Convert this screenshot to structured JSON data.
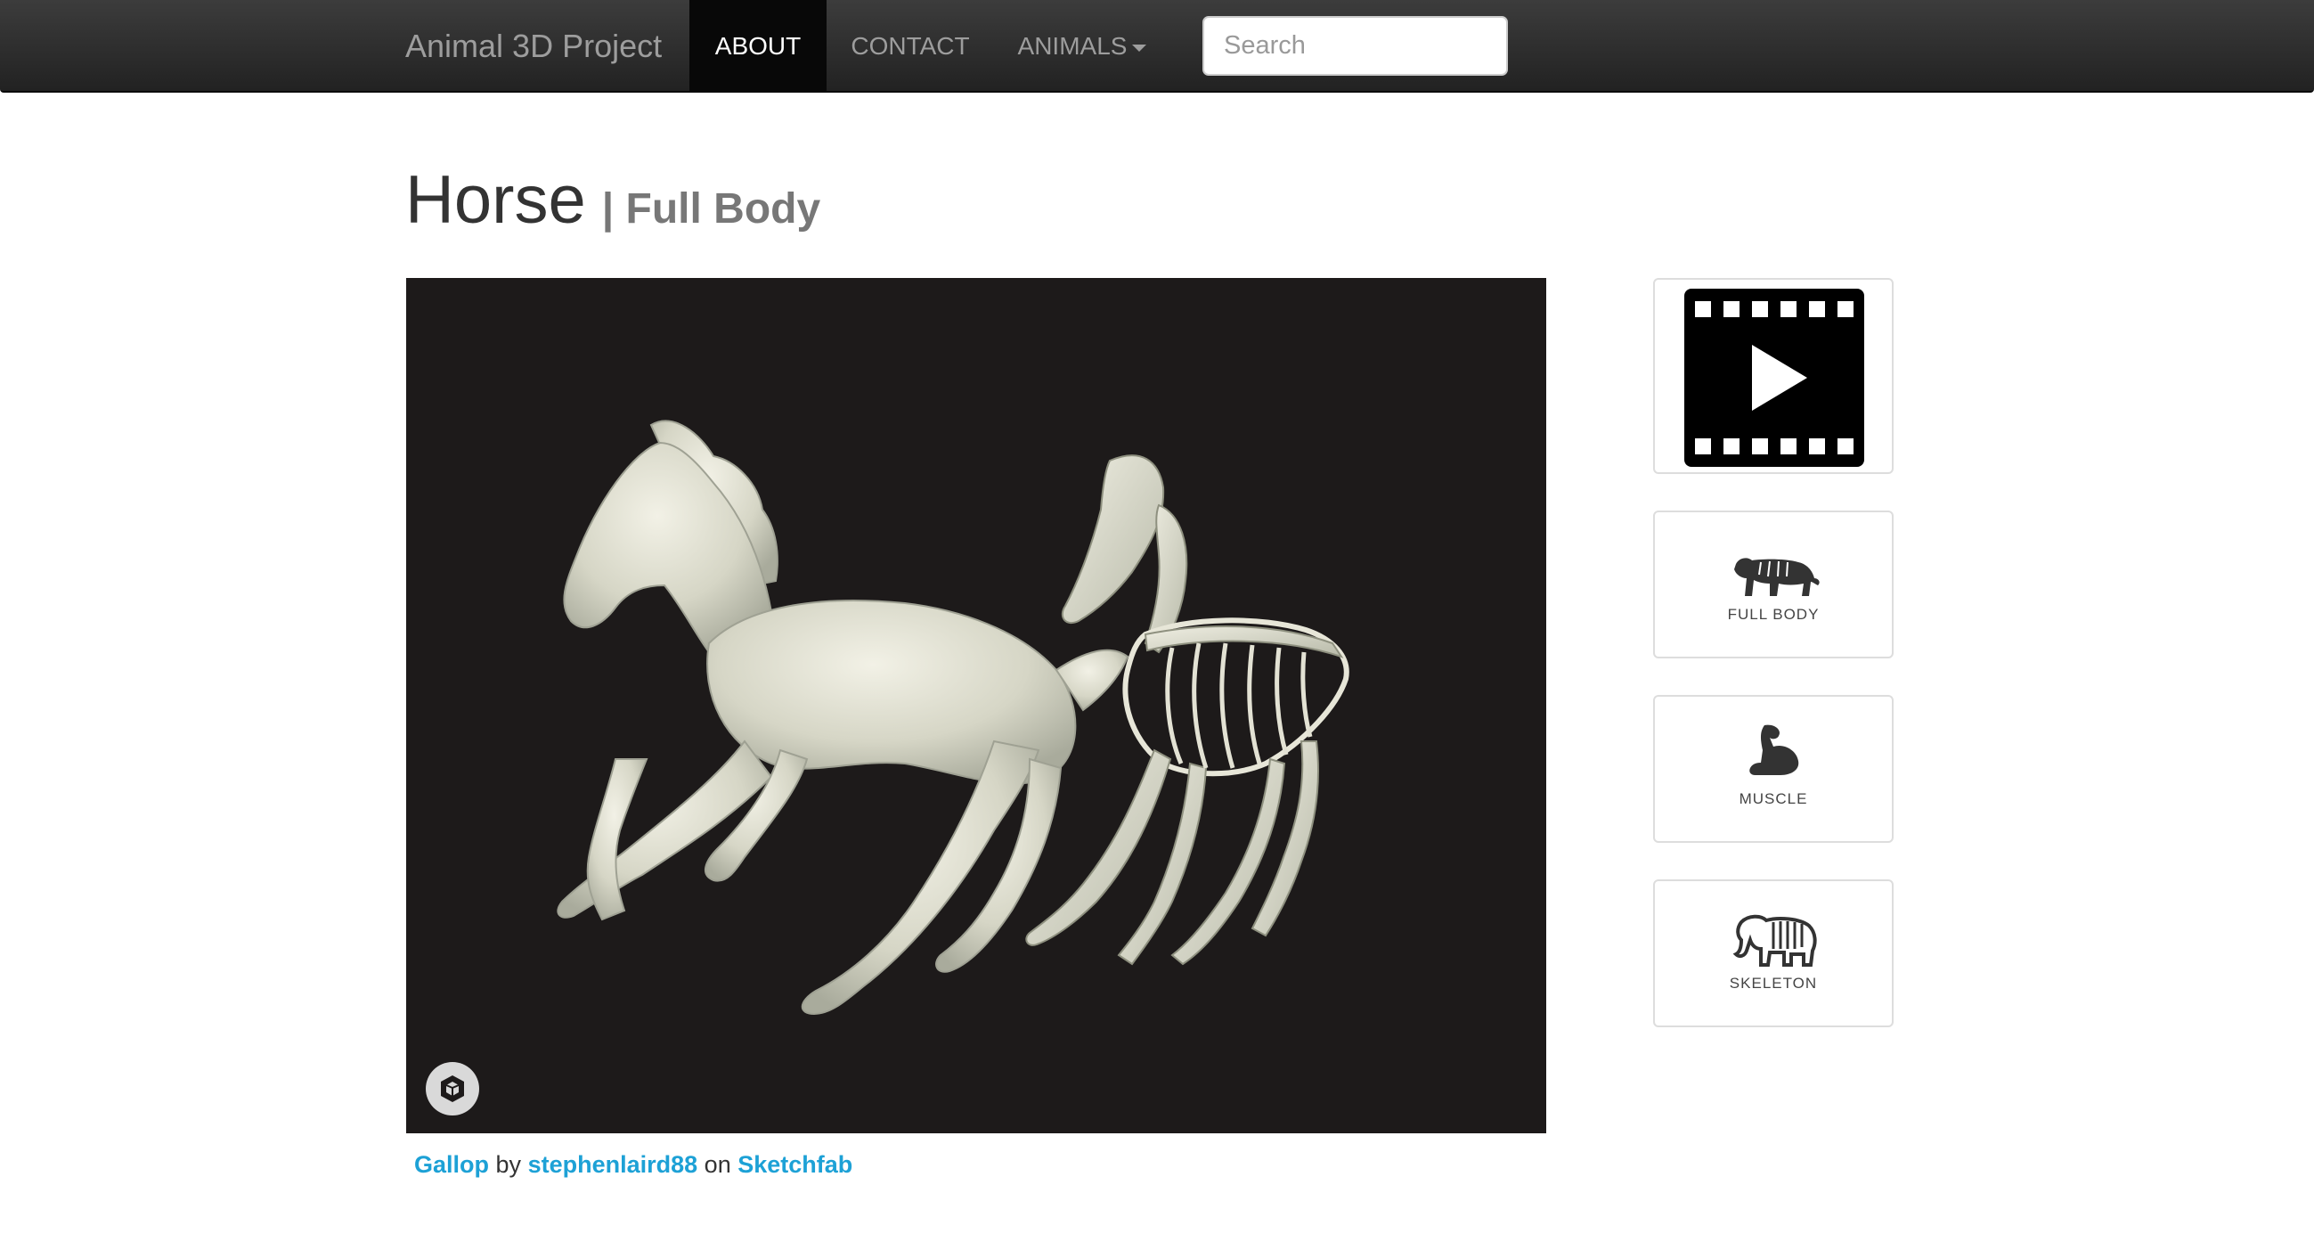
{
  "navbar": {
    "brand": "Animal 3D Project",
    "items": [
      {
        "label": "ABOUT",
        "active": true
      },
      {
        "label": "CONTACT",
        "active": false
      },
      {
        "label": "ANIMALS",
        "active": false,
        "dropdown": true
      }
    ],
    "search_placeholder": "Search"
  },
  "page": {
    "title": "Horse",
    "subtitle": "| Full Body"
  },
  "viewer": {
    "icon": "sketchfab-logo-icon"
  },
  "credit": {
    "model": "Gallop",
    "by": "by",
    "author": "stephenlaird88",
    "on": "on",
    "site": "Sketchfab"
  },
  "tiles": [
    {
      "icon": "video-play-icon",
      "label": ""
    },
    {
      "icon": "tiger-icon",
      "label": "FULL BODY"
    },
    {
      "icon": "flexed-arm-icon",
      "label": "MUSCLE"
    },
    {
      "icon": "elephant-skeleton-icon",
      "label": "SKELETON"
    }
  ],
  "colors": {
    "navbar_bg": "#222222",
    "active_nav_bg": "#080808",
    "link": "#1da1d6",
    "viewer_bg": "#1d1a1a",
    "model": "#d8d8c8"
  }
}
